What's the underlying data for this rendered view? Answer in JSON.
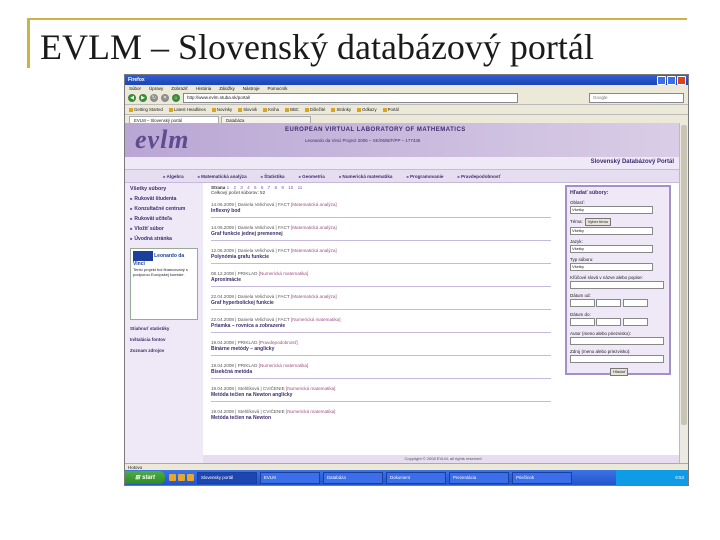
{
  "slide": {
    "title": "EVLM – Slovenský databázový portál"
  },
  "browser": {
    "window_title": "Firefox",
    "menu": [
      "Súbor",
      "Úpravy",
      "Zobraziť",
      "História",
      "Záložky",
      "Nástroje",
      "Pomocník"
    ],
    "url": "http://www.evlm.stuba.sk/portal/",
    "search_placeholder": "Google",
    "bookmarks": [
      "Getting Started",
      "Latest Headlines",
      "Novinky",
      "Slovnik",
      "Kniha",
      "BBC",
      "Dôležité",
      "Stránky",
      "Odkazy",
      "Portál"
    ],
    "tabs": [
      "EVLM – Slovenský portál",
      "Databáza"
    ]
  },
  "page": {
    "logo": "evlm",
    "header_title": "EUROPEAN VIRTUAL LABORATORY OF MATHEMATICS",
    "header_sub": "Leonardo da Vinci Project 2006 – SK/06/B/F/PP – 177436",
    "portal_name": "Slovenský Databázový Portál",
    "menu": [
      "Algebra",
      "Matematická analýza",
      "Štatistika",
      "Geometria",
      "Numerická matematika",
      "Programovanie",
      "Pravdepodobnosť"
    ],
    "left": {
      "section": "Všetky súbory",
      "items": [
        "Rukovät študenta",
        "Konzultačné centrum",
        "Rukovät učiteľa",
        "Vložiť súbor",
        "Úvodná stránka"
      ],
      "leo_title": "Leonardo da Vinci",
      "leo_text": "Tento projekt bol financovaný s podporou Európskej komisie.",
      "download_label": "Stiahnuť statistiky",
      "install_label": "Inštalácia fontov",
      "links_label": "Zoznam zdrojov"
    },
    "main": {
      "pager_label": "Strana",
      "pages": [
        "1",
        "2",
        "3",
        "4",
        "5",
        "6",
        "7",
        "8",
        "9",
        "10",
        "11"
      ],
      "count_label": "Celkový počet súborov: 52",
      "entries": [
        {
          "meta": "14.06.2009 | Daniela Velichová | FACT",
          "area": "[Matematická analýza]",
          "name": "Inflexný bod"
        },
        {
          "meta": "14.06.2009 | Daniela Velichová | FACT",
          "area": "[Matematická analýza]",
          "name": "Graf funkcie jednej premennej"
        },
        {
          "meta": "12.06.2009 | Daniela Velichová | FACT",
          "area": "[Matematická analýza]",
          "name": "Polynómia grafu funkcie"
        },
        {
          "meta": "08.12.2008 | PRIKLAD",
          "area": "[Numerická matematika]",
          "name": "Aproximácie"
        },
        {
          "meta": "22.04.2008 | Daniela Velichová | FACT",
          "area": "[Matematická analýza]",
          "name": "Graf hyperbolickej funkcie"
        },
        {
          "meta": "22.04.2008 | Daniela Velichová | FACT",
          "area": "[Numerická matematika]",
          "name": "Priamka – rovnica a zobrazenie"
        },
        {
          "meta": "19.04.2008 | PRIKLAD",
          "area": "[Pravdepodobnosť]",
          "name": "Binárne metódy – anglicky"
        },
        {
          "meta": "19.04.2008 | PRIKLAD",
          "area": "[Numerická matematika]",
          "name": "Bisekčná metóda"
        },
        {
          "meta": "19.04.2008 | Stehlíková | CVIČENIE",
          "area": "[Numerická matematika]",
          "name": "Metóda tečien na Newton anglicky"
        },
        {
          "meta": "19.04.2008 | Stehlíková | CVIČENIE",
          "area": "[Numerická matematika]",
          "name": "Metóda tečien na Newton"
        }
      ]
    },
    "right": {
      "title": "Hľadať súbory:",
      "fields": [
        {
          "label": "Oblasť:",
          "value": "Všetky"
        },
        {
          "label": "Téma:",
          "value": "Všetky"
        },
        {
          "label": "Jazyk:",
          "value": "Všetky"
        },
        {
          "label": "Typ súboru:",
          "value": "Všetky"
        }
      ],
      "topic_button": "Vyber tému",
      "keyword_label": "Kľúčové slová v názve alebo popise:",
      "date_from_label": "Dátum od:",
      "date_to_label": "Dátum do:",
      "author_label": "Autor (meno alebo priezvisko):",
      "source_label": "Zdroj (meno alebo priezvisko):",
      "search_button": "Hľadať"
    },
    "footer": "Copyright © 2008 EVLM, all rights reserved"
  },
  "status_text": "Hotovo",
  "taskbar": {
    "start": "start",
    "tasks": [
      "Slovensky portál",
      "EVLM",
      "Databáza",
      "Dokument",
      "Prezentácia",
      "Priečinok",
      "Kalkulačka"
    ],
    "clock": "9:53"
  }
}
